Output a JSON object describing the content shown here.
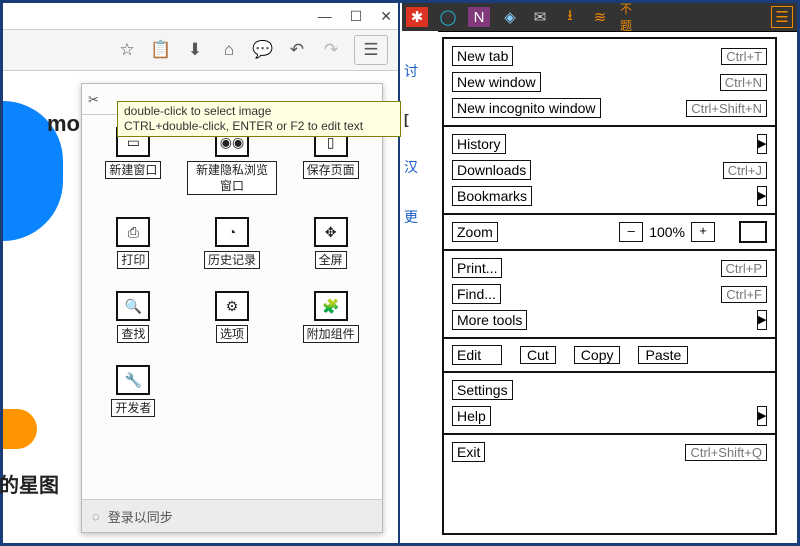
{
  "left": {
    "titlebar_controls": [
      "min",
      "max",
      "close"
    ],
    "toolbar_icons": [
      "star",
      "clipboard",
      "download",
      "home",
      "chat",
      "undo",
      "redo",
      "menu"
    ],
    "bg_text_mo": "mo",
    "bg_text_star": "的星图",
    "tooltip": {
      "line1": "double-click to select image",
      "line2": "CTRL+double-click, ENTER or F2 to edit text"
    },
    "panel": {
      "items": [
        {
          "label": "新建窗口",
          "icon": "window"
        },
        {
          "label": "新建隐私浏览窗口",
          "icon": "mask"
        },
        {
          "label": "保存页面",
          "icon": "page"
        },
        {
          "label": "打印",
          "icon": "print"
        },
        {
          "label": "历史记录",
          "icon": "clock"
        },
        {
          "label": "全屏",
          "icon": "arrows"
        },
        {
          "label": "查找",
          "icon": "search"
        },
        {
          "label": "选项",
          "icon": "gear"
        },
        {
          "label": "附加组件",
          "icon": "puzzle"
        },
        {
          "label": "开发者",
          "icon": "wrench"
        }
      ],
      "footer": "登录以同步"
    }
  },
  "right": {
    "ext_icons": [
      "lastpass",
      "cortana",
      "onenote",
      "diamond",
      "mail",
      "download",
      "swirl",
      "cjk",
      "menu"
    ],
    "sections": [
      {
        "rows": [
          {
            "label": "New tab",
            "shortcut": "Ctrl+T"
          },
          {
            "label": "New window",
            "shortcut": "Ctrl+N"
          },
          {
            "label": "New incognito window",
            "shortcut": "Ctrl+Shift+N"
          }
        ]
      },
      {
        "rows": [
          {
            "label": "History",
            "submenu": true
          },
          {
            "label": "Downloads",
            "shortcut": "Ctrl+J"
          },
          {
            "label": "Bookmarks",
            "submenu": true
          }
        ]
      },
      {
        "zoom": {
          "label": "Zoom",
          "minus": "–",
          "value": "100%",
          "plus": "+"
        }
      },
      {
        "rows": [
          {
            "label": "Print...",
            "shortcut": "Ctrl+P"
          },
          {
            "label": "Find...",
            "shortcut": "Ctrl+F"
          },
          {
            "label": "More tools",
            "submenu": true
          }
        ]
      },
      {
        "edit": {
          "label": "Edit",
          "cut": "Cut",
          "copy": "Copy",
          "paste": "Paste"
        }
      },
      {
        "rows": [
          {
            "label": "Settings"
          },
          {
            "label": "Help",
            "submenu": true
          }
        ]
      },
      {
        "rows": [
          {
            "label": "Exit",
            "shortcut": "Ctrl+Shift+Q"
          }
        ]
      }
    ]
  }
}
